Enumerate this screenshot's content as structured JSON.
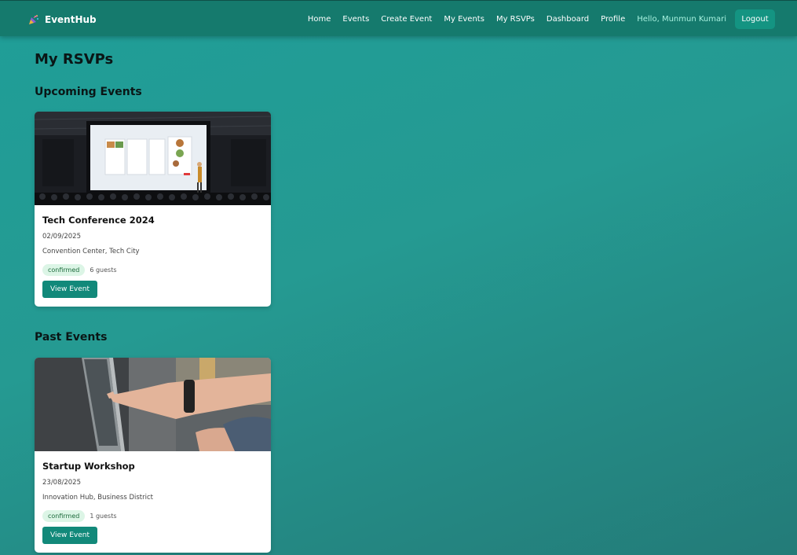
{
  "brand": {
    "name": "EventHub",
    "icon": "party-popper-icon"
  },
  "nav": {
    "links": [
      "Home",
      "Events",
      "Create Event",
      "My Events",
      "My RSVPs",
      "Dashboard",
      "Profile"
    ],
    "greeting": "Hello, Munmun Kumari",
    "logout_label": "Logout"
  },
  "page": {
    "title": "My RSVPs",
    "upcoming_heading": "Upcoming Events",
    "past_heading": "Past Events"
  },
  "upcoming": [
    {
      "title": "Tech Conference 2024",
      "date": "02/09/2025",
      "location": "Convention Center, Tech City",
      "status": "confirmed",
      "guests": "6 guests",
      "button": "View Event",
      "image": "conference-stage-photo"
    }
  ],
  "past": [
    {
      "title": "Startup Workshop",
      "date": "23/08/2025",
      "location": "Innovation Hub, Business District",
      "status": "confirmed",
      "guests": "1 guests",
      "button": "View Event",
      "image": "laptop-hands-photo"
    }
  ],
  "colors": {
    "navbar": "#157a6d",
    "accent": "#12897a",
    "greeting": "#a8f2e0",
    "badge_bg": "#dcf5e6",
    "badge_text": "#1d6b3c"
  }
}
